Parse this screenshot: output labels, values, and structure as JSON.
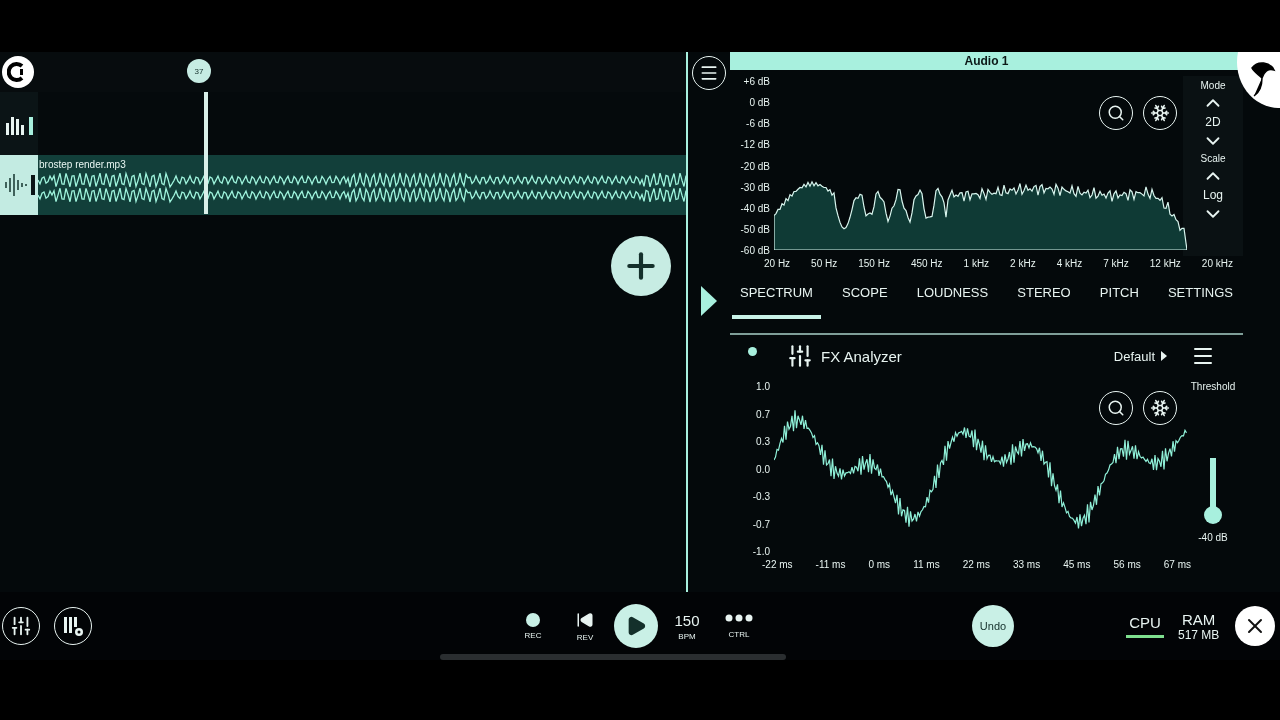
{
  "timeline": {
    "playhead": "37"
  },
  "tracks": [
    {
      "kind": "mixer"
    },
    {
      "kind": "audio",
      "clip_name": "brostep render.mp3"
    }
  ],
  "analyzer": {
    "title": "Audio 1",
    "spectrum": {
      "y_labels": [
        "+6 dB",
        "0 dB",
        "-6 dB",
        "-12 dB",
        "-20 dB",
        "-30 dB",
        "-40 dB",
        "-50 dB",
        "-60 dB"
      ],
      "x_labels": [
        "20 Hz",
        "50 Hz",
        "150 Hz",
        "450 Hz",
        "1 kHz",
        "2 kHz",
        "4 kHz",
        "7 kHz",
        "12 kHz",
        "20 kHz"
      ]
    },
    "mode_label": "Mode",
    "mode": "2D",
    "scale_label": "Scale",
    "scale": "Log",
    "tabs": [
      {
        "label": "SPECTRUM",
        "selected": true
      },
      {
        "label": "SCOPE",
        "selected": false
      },
      {
        "label": "LOUDNESS",
        "selected": false
      },
      {
        "label": "STEREO",
        "selected": false
      },
      {
        "label": "PITCH",
        "selected": false
      },
      {
        "label": "SETTINGS",
        "selected": false
      }
    ]
  },
  "fx": {
    "enabled": true,
    "title": "FX Analyzer",
    "preset": "Default",
    "scope": {
      "y_labels": [
        "1.0",
        "0.7",
        "0.3",
        "0.0",
        "-0.3",
        "-0.7",
        "-1.0"
      ],
      "x_labels": [
        "-22 ms",
        "-11 ms",
        "0 ms",
        "11 ms",
        "22 ms",
        "33 ms",
        "45 ms",
        "56 ms",
        "67 ms"
      ]
    },
    "threshold": {
      "label": "Threshold",
      "level": 0.05,
      "reading": "-40 dB"
    }
  },
  "transport": [
    {
      "kind": "rec",
      "label": "REC"
    },
    {
      "kind": "rev",
      "label": "REV"
    },
    {
      "kind": "play"
    },
    {
      "kind": "bpm",
      "value": "150",
      "label": "BPM"
    },
    {
      "kind": "ctrl",
      "label": "CTRL"
    }
  ],
  "undo": "Undo",
  "cpu": {
    "label": "CPU",
    "level": 1
  },
  "ram": {
    "label": "RAM",
    "value": "517 MB"
  }
}
